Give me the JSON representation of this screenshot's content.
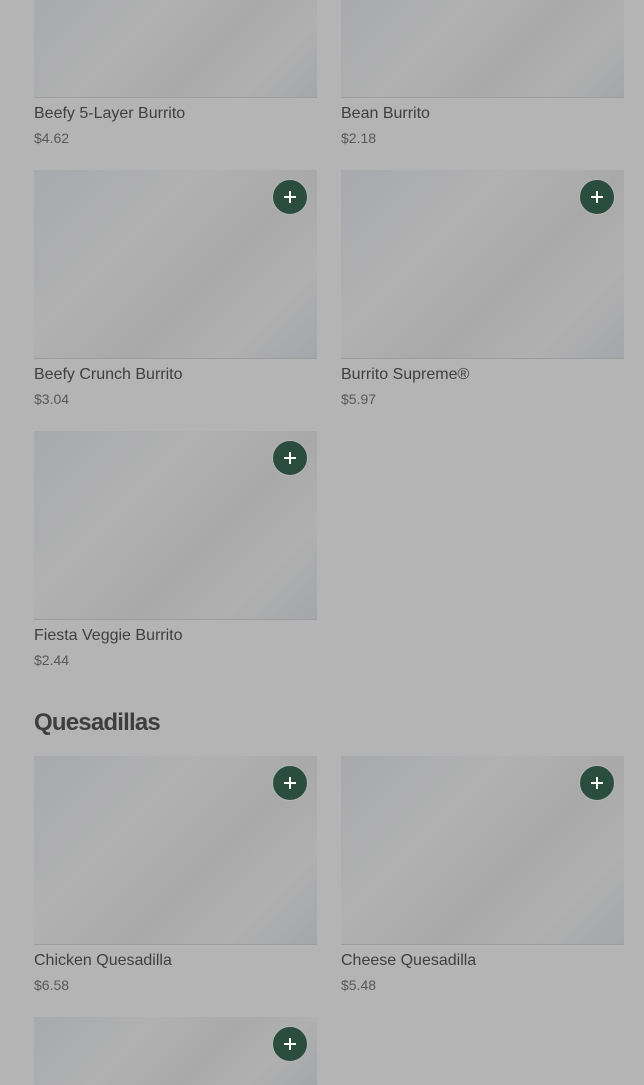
{
  "burritos": [
    {
      "name": "Beefy 5-Layer Burrito",
      "price": "$4.62"
    },
    {
      "name": "Bean Burrito",
      "price": "$2.18"
    },
    {
      "name": "Beefy Crunch Burrito",
      "price": "$3.04"
    },
    {
      "name": "Burrito Supreme®",
      "price": "$5.97"
    },
    {
      "name": "Fiesta Veggie Burrito",
      "price": "$2.44"
    }
  ],
  "quesadillas_section": {
    "title": "Quesadillas"
  },
  "quesadillas": [
    {
      "name": "Chicken Quesadilla",
      "price": "$6.58"
    },
    {
      "name": "Cheese Quesadilla",
      "price": "$5.48"
    }
  ],
  "add_button_icon": "plus-icon",
  "colors": {
    "page_background": "#b4b4b4",
    "add_button": "#2b4d40",
    "item_name": "#3f3f3f",
    "item_price": "#585858"
  }
}
